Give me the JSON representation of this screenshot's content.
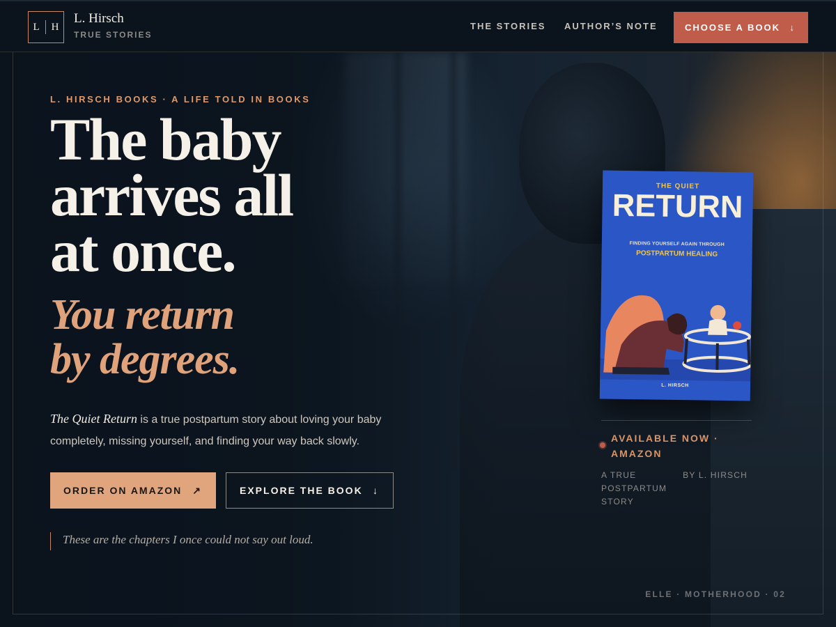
{
  "colors": {
    "background": "#0b141d",
    "accent_peach": "#e1a57d",
    "accent_red": "#c05c4a",
    "book_blue": "#2b57c6",
    "book_yellow": "#f2c64a"
  },
  "header": {
    "logo_left": "L",
    "logo_right": "H",
    "brand_name": "L. Hirsch",
    "brand_sub": "TRUE STORIES",
    "nav": [
      {
        "label": "THE STORIES"
      },
      {
        "label": "AUTHOR’S NOTE"
      }
    ],
    "cta_label": "CHOOSE A BOOK",
    "cta_icon": "arrow-down-icon",
    "cta_arrow": "↓"
  },
  "hero": {
    "eyebrow": "L. HIRSCH BOOKS · A LIFE TOLD IN BOOKS",
    "headline_lines": [
      "The baby",
      "arrives all",
      "at once."
    ],
    "accent_lines": [
      "You return",
      "by degrees."
    ],
    "intro_title": "The Quiet Return",
    "intro_rest": " is a true postpartum story about loving your baby completely, missing yourself, and finding your way back slowly.",
    "primary_label": "ORDER ON AMAZON",
    "primary_icon": "arrow-up-right-icon",
    "primary_arrow": "↗",
    "secondary_label": "EXPLORE THE BOOK",
    "secondary_icon": "arrow-down-icon",
    "secondary_arrow": "↓",
    "quote": "These are the chapters I once could not say out loud."
  },
  "book": {
    "kicker": "THE QUIET",
    "title": "RETURN",
    "subtitle_line1": "FINDING YOURSELF AGAIN THROUGH",
    "subtitle_line2": "POSTPARTUM HEALING",
    "author": "L. HIRSCH"
  },
  "availability": {
    "status": "AVAILABLE NOW · AMAZON",
    "meta_left": "A TRUE POSTPARTUM STORY",
    "meta_right": "BY L. HIRSCH"
  },
  "footer_tag": "ELLE · MOTHERHOOD · 02"
}
